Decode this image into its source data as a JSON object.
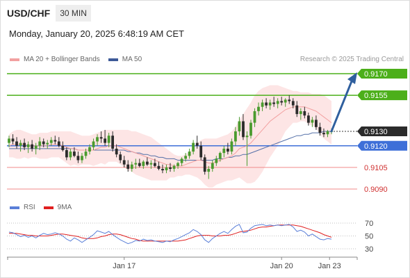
{
  "header": {
    "symbol": "USD/CHF",
    "timeframe": "30 MIN"
  },
  "datetime": "Monday, January 20, 2025 6:48:19 AM CET",
  "legend": {
    "ma20_label": "MA 20 + Bollinger Bands",
    "ma50_label": "MA 50",
    "research": "Research © 2025 Trading Central",
    "rsi_label": "RSI",
    "rsi_ma_label": "9MA"
  },
  "colors": {
    "up": "#4a9b2e",
    "down": "#2b2b2b",
    "green_level": "#4caf1a",
    "blue_level": "#3e6fd8",
    "red_level": "#f08a8a",
    "band_fill": "#fde0e0",
    "ma20": "#f2a0a0",
    "ma50": "#5570a8",
    "arrow": "#2f5f9e",
    "rsi": "#5a7fd8",
    "rsi_ma": "#e02020",
    "current_price_bg": "#2b2b2b"
  },
  "chart_data": [
    {
      "type": "candlestick",
      "instrument": "USD/CHF",
      "interval": "30 MIN",
      "ylim": [
        0.908,
        0.918
      ],
      "x_ticks": [
        "Jan 17",
        "Jan 20",
        "Jan 23"
      ],
      "current_price": "0.9130",
      "levels": [
        {
          "value": "0.9170",
          "kind": "resistance",
          "style": "green"
        },
        {
          "value": "0.9155",
          "kind": "resistance",
          "style": "green"
        },
        {
          "value": "0.9120",
          "kind": "pivot",
          "style": "blue"
        },
        {
          "value": "0.9105",
          "kind": "support",
          "style": "red"
        },
        {
          "value": "0.9090",
          "kind": "support",
          "style": "red"
        }
      ],
      "candles": [
        [
          0.9122,
          0.9127,
          0.9119,
          0.9125
        ],
        [
          0.9125,
          0.9128,
          0.9121,
          0.9123
        ],
        [
          0.9123,
          0.9126,
          0.9118,
          0.912
        ],
        [
          0.912,
          0.9124,
          0.9116,
          0.9122
        ],
        [
          0.9122,
          0.9125,
          0.9117,
          0.9119
        ],
        [
          0.9119,
          0.9123,
          0.9115,
          0.9121
        ],
        [
          0.9121,
          0.9124,
          0.9116,
          0.9118
        ],
        [
          0.9118,
          0.9122,
          0.9114,
          0.912
        ],
        [
          0.912,
          0.9126,
          0.9117,
          0.9123
        ],
        [
          0.9123,
          0.9125,
          0.9119,
          0.9121
        ],
        [
          0.9121,
          0.9124,
          0.9118,
          0.9122
        ],
        [
          0.9122,
          0.9126,
          0.912,
          0.9124
        ],
        [
          0.9124,
          0.9127,
          0.9121,
          0.9123
        ],
        [
          0.9123,
          0.9126,
          0.9119,
          0.912
        ],
        [
          0.912,
          0.9123,
          0.9116,
          0.9117
        ],
        [
          0.9117,
          0.9119,
          0.911,
          0.9112
        ],
        [
          0.9112,
          0.9118,
          0.911,
          0.9116
        ],
        [
          0.9116,
          0.9119,
          0.9112,
          0.9113
        ],
        [
          0.9113,
          0.9116,
          0.9108,
          0.911
        ],
        [
          0.911,
          0.9115,
          0.9108,
          0.9113
        ],
        [
          0.9113,
          0.9118,
          0.9111,
          0.9116
        ],
        [
          0.9116,
          0.9121,
          0.9114,
          0.9119
        ],
        [
          0.9119,
          0.9125,
          0.9117,
          0.9123
        ],
        [
          0.9123,
          0.9128,
          0.912,
          0.9126
        ],
        [
          0.9126,
          0.913,
          0.9122,
          0.9125
        ],
        [
          0.9125,
          0.9131,
          0.912,
          0.9122
        ],
        [
          0.9122,
          0.9129,
          0.9119,
          0.9127
        ],
        [
          0.9127,
          0.913,
          0.9116,
          0.9118
        ],
        [
          0.9118,
          0.9121,
          0.9112,
          0.9114
        ],
        [
          0.9114,
          0.9116,
          0.9108,
          0.911
        ],
        [
          0.911,
          0.9113,
          0.9105,
          0.9107
        ],
        [
          0.9107,
          0.911,
          0.9102,
          0.9104
        ],
        [
          0.9104,
          0.9109,
          0.9102,
          0.9107
        ],
        [
          0.9107,
          0.9111,
          0.9104,
          0.9108
        ],
        [
          0.9108,
          0.9111,
          0.9105,
          0.9106
        ],
        [
          0.9106,
          0.911,
          0.9104,
          0.9109
        ],
        [
          0.9109,
          0.9112,
          0.9106,
          0.9107
        ],
        [
          0.9107,
          0.911,
          0.9104,
          0.9108
        ],
        [
          0.9108,
          0.9111,
          0.9105,
          0.9106
        ],
        [
          0.9106,
          0.9109,
          0.9103,
          0.9104
        ],
        [
          0.9104,
          0.9107,
          0.9101,
          0.9103
        ],
        [
          0.9103,
          0.9107,
          0.9101,
          0.9105
        ],
        [
          0.9105,
          0.9108,
          0.9102,
          0.9104
        ],
        [
          0.9104,
          0.9107,
          0.9102,
          0.9106
        ],
        [
          0.9106,
          0.9109,
          0.9104,
          0.9108
        ],
        [
          0.9108,
          0.9112,
          0.9106,
          0.9111
        ],
        [
          0.9111,
          0.9115,
          0.9109,
          0.9113
        ],
        [
          0.9113,
          0.9118,
          0.9111,
          0.9116
        ],
        [
          0.9116,
          0.9124,
          0.9114,
          0.9122
        ],
        [
          0.9122,
          0.9127,
          0.9118,
          0.912
        ],
        [
          0.912,
          0.9123,
          0.911,
          0.9112
        ],
        [
          0.9112,
          0.9114,
          0.91,
          0.9102
        ],
        [
          0.9102,
          0.9106,
          0.9097,
          0.9104
        ],
        [
          0.9104,
          0.911,
          0.9102,
          0.9108
        ],
        [
          0.9108,
          0.9113,
          0.9106,
          0.9111
        ],
        [
          0.9111,
          0.9116,
          0.9109,
          0.9115
        ],
        [
          0.9115,
          0.912,
          0.9112,
          0.9118
        ],
        [
          0.9118,
          0.9122,
          0.9114,
          0.9116
        ],
        [
          0.9116,
          0.9125,
          0.9114,
          0.9123
        ],
        [
          0.9123,
          0.9133,
          0.912,
          0.913
        ],
        [
          0.913,
          0.914,
          0.9127,
          0.9137
        ],
        [
          0.9137,
          0.9142,
          0.9124,
          0.9126
        ],
        [
          0.9126,
          0.913,
          0.9106,
          0.9127
        ],
        [
          0.9127,
          0.9138,
          0.9125,
          0.9136
        ],
        [
          0.9136,
          0.9146,
          0.9133,
          0.9144
        ],
        [
          0.9144,
          0.915,
          0.9141,
          0.9147
        ],
        [
          0.9147,
          0.9152,
          0.9144,
          0.915
        ],
        [
          0.915,
          0.9153,
          0.9146,
          0.9148
        ],
        [
          0.9148,
          0.9152,
          0.9145,
          0.915
        ],
        [
          0.915,
          0.9154,
          0.9147,
          0.9149
        ],
        [
          0.9149,
          0.9153,
          0.9146,
          0.9151
        ],
        [
          0.9151,
          0.9154,
          0.9148,
          0.915
        ],
        [
          0.915,
          0.9153,
          0.9147,
          0.9152
        ],
        [
          0.9152,
          0.9155,
          0.9149,
          0.9151
        ],
        [
          0.9151,
          0.9153,
          0.9146,
          0.9148
        ],
        [
          0.9148,
          0.9151,
          0.914,
          0.9142
        ],
        [
          0.9142,
          0.9146,
          0.9138,
          0.9144
        ],
        [
          0.9144,
          0.9147,
          0.9139,
          0.9141
        ],
        [
          0.9141,
          0.9143,
          0.9134,
          0.9136
        ],
        [
          0.9136,
          0.914,
          0.9133,
          0.9138
        ],
        [
          0.9138,
          0.9141,
          0.9131,
          0.9133
        ],
        [
          0.9133,
          0.9136,
          0.9127,
          0.9129
        ],
        [
          0.9129,
          0.9132,
          0.9126,
          0.9128
        ],
        [
          0.9128,
          0.9131,
          0.9126,
          0.913
        ],
        [
          0.913,
          0.9132,
          0.9128,
          0.913
        ]
      ],
      "ma20": [
        0.912,
        0.9121,
        0.9121,
        0.9121,
        0.9121,
        0.912,
        0.912,
        0.912,
        0.912,
        0.912,
        0.912,
        0.9121,
        0.9121,
        0.9121,
        0.912,
        0.9119,
        0.9118,
        0.9118,
        0.9117,
        0.9117,
        0.9117,
        0.9117,
        0.9117,
        0.9118,
        0.9119,
        0.9119,
        0.912,
        0.912,
        0.912,
        0.9119,
        0.9118,
        0.9117,
        0.9116,
        0.9115,
        0.9114,
        0.9113,
        0.9112,
        0.9111,
        0.911,
        0.9109,
        0.9108,
        0.9107,
        0.9107,
        0.9106,
        0.9106,
        0.9106,
        0.9107,
        0.9108,
        0.9109,
        0.911,
        0.911,
        0.9109,
        0.9108,
        0.9108,
        0.9109,
        0.911,
        0.9111,
        0.9112,
        0.9113,
        0.9115,
        0.9118,
        0.9119,
        0.912,
        0.9122,
        0.9125,
        0.9128,
        0.9131,
        0.9134,
        0.9137,
        0.9139,
        0.9141,
        0.9143,
        0.9145,
        0.9146,
        0.9147,
        0.9147,
        0.9147,
        0.9147,
        0.9146,
        0.9145,
        0.9144,
        0.9142,
        0.914,
        0.9138,
        0.9136
      ],
      "ma50": [
        0.9118,
        0.9118,
        0.9118,
        0.9118,
        0.9118,
        0.9118,
        0.9118,
        0.9118,
        0.9118,
        0.9118,
        0.9118,
        0.9118,
        0.9118,
        0.9118,
        0.9118,
        0.9118,
        0.9118,
        0.9118,
        0.9117,
        0.9117,
        0.9117,
        0.9117,
        0.9117,
        0.9117,
        0.9117,
        0.9117,
        0.9117,
        0.9117,
        0.9117,
        0.9117,
        0.9117,
        0.9116,
        0.9116,
        0.9115,
        0.9115,
        0.9114,
        0.9114,
        0.9113,
        0.9113,
        0.9112,
        0.9112,
        0.9111,
        0.9111,
        0.9111,
        0.911,
        0.911,
        0.911,
        0.911,
        0.911,
        0.911,
        0.911,
        0.911,
        0.911,
        0.911,
        0.9111,
        0.9111,
        0.9111,
        0.9112,
        0.9112,
        0.9113,
        0.9113,
        0.9114,
        0.9114,
        0.9115,
        0.9116,
        0.9117,
        0.9118,
        0.9119,
        0.912,
        0.9121,
        0.9122,
        0.9123,
        0.9124,
        0.9125,
        0.9126,
        0.9127,
        0.9127,
        0.9128,
        0.9128,
        0.9129,
        0.9129,
        0.9129,
        0.913,
        0.913,
        0.913
      ],
      "bb_upper": [
        0.9128,
        0.913,
        0.9131,
        0.9131,
        0.913,
        0.9129,
        0.9128,
        0.9128,
        0.9129,
        0.9129,
        0.9129,
        0.913,
        0.913,
        0.913,
        0.913,
        0.913,
        0.913,
        0.9129,
        0.9128,
        0.9127,
        0.9127,
        0.9127,
        0.9128,
        0.9129,
        0.913,
        0.9131,
        0.9131,
        0.9131,
        0.9131,
        0.9131,
        0.9131,
        0.9131,
        0.913,
        0.913,
        0.9129,
        0.9128,
        0.9127,
        0.9126,
        0.9124,
        0.9122,
        0.912,
        0.9118,
        0.9116,
        0.9114,
        0.9113,
        0.9113,
        0.9114,
        0.9116,
        0.9119,
        0.9122,
        0.9124,
        0.9125,
        0.9125,
        0.9125,
        0.9125,
        0.9126,
        0.9127,
        0.9128,
        0.913,
        0.9133,
        0.9138,
        0.9142,
        0.9146,
        0.915,
        0.9155,
        0.9158,
        0.916,
        0.9161,
        0.9162,
        0.9162,
        0.9162,
        0.9161,
        0.916,
        0.9159,
        0.9158,
        0.9158,
        0.9157,
        0.9157,
        0.9157,
        0.9156,
        0.9156,
        0.9156,
        0.9155,
        0.9153,
        0.9151
      ],
      "bb_lower": [
        0.9112,
        0.9112,
        0.9111,
        0.9111,
        0.9112,
        0.9111,
        0.9112,
        0.9112,
        0.9111,
        0.9111,
        0.9111,
        0.9112,
        0.9112,
        0.9112,
        0.911,
        0.9108,
        0.9106,
        0.9107,
        0.9106,
        0.9107,
        0.9107,
        0.9107,
        0.9106,
        0.9107,
        0.9108,
        0.9107,
        0.9109,
        0.9109,
        0.9109,
        0.9107,
        0.9105,
        0.9103,
        0.9102,
        0.91,
        0.9099,
        0.9098,
        0.9097,
        0.9096,
        0.9096,
        0.9096,
        0.9096,
        0.9096,
        0.9098,
        0.9098,
        0.9099,
        0.9099,
        0.91,
        0.91,
        0.9099,
        0.9098,
        0.9096,
        0.9093,
        0.9091,
        0.9091,
        0.9093,
        0.9094,
        0.9095,
        0.9096,
        0.9096,
        0.9097,
        0.9098,
        0.9096,
        0.9094,
        0.9094,
        0.9095,
        0.9098,
        0.9102,
        0.9107,
        0.9112,
        0.9116,
        0.912,
        0.9125,
        0.913,
        0.9133,
        0.9136,
        0.9136,
        0.9137,
        0.9137,
        0.9135,
        0.9134,
        0.9132,
        0.9128,
        0.9125,
        0.9123,
        0.9121
      ],
      "arrow": {
        "from": 0.913,
        "to": 0.917
      }
    },
    {
      "type": "line",
      "title": "RSI",
      "ylim": [
        25,
        75
      ],
      "y_ticks": [
        "70",
        "50",
        "30"
      ],
      "x_ticks": [
        "Jan 17",
        "Jan 20",
        "Jan 23"
      ],
      "series": [
        {
          "name": "RSI",
          "values": [
            56,
            55,
            52,
            49,
            51,
            48,
            50,
            47,
            51,
            54,
            52,
            53,
            55,
            53,
            50,
            45,
            42,
            47,
            44,
            40,
            44,
            48,
            52,
            58,
            56,
            54,
            57,
            52,
            48,
            44,
            41,
            38,
            40,
            43,
            42,
            45,
            43,
            44,
            42,
            41,
            40,
            42,
            41,
            44,
            46,
            49,
            52,
            55,
            60,
            57,
            52,
            44,
            40,
            46,
            50,
            54,
            57,
            54,
            60,
            65,
            68,
            55,
            56,
            62,
            66,
            67,
            68,
            66,
            67,
            66,
            67,
            66,
            67,
            68,
            64,
            57,
            59,
            56,
            50,
            53,
            49,
            45,
            44,
            46,
            45
          ]
        },
        {
          "name": "9MA",
          "values": [
            54,
            54,
            54,
            53,
            52,
            51,
            51,
            50,
            50,
            50,
            50,
            51,
            52,
            53,
            53,
            52,
            51,
            50,
            49,
            47,
            46,
            46,
            46,
            47,
            49,
            50,
            52,
            53,
            53,
            52,
            50,
            48,
            46,
            45,
            43,
            42,
            42,
            42,
            42,
            42,
            42,
            42,
            42,
            42,
            42,
            43,
            44,
            46,
            48,
            50,
            51,
            51,
            51,
            50,
            50,
            50,
            51,
            51,
            52,
            54,
            56,
            57,
            58,
            59,
            61,
            63,
            64,
            64,
            65,
            66,
            67,
            67,
            67,
            67,
            67,
            66,
            65,
            63,
            61,
            59,
            57,
            55,
            52,
            50,
            48
          ]
        }
      ]
    }
  ]
}
